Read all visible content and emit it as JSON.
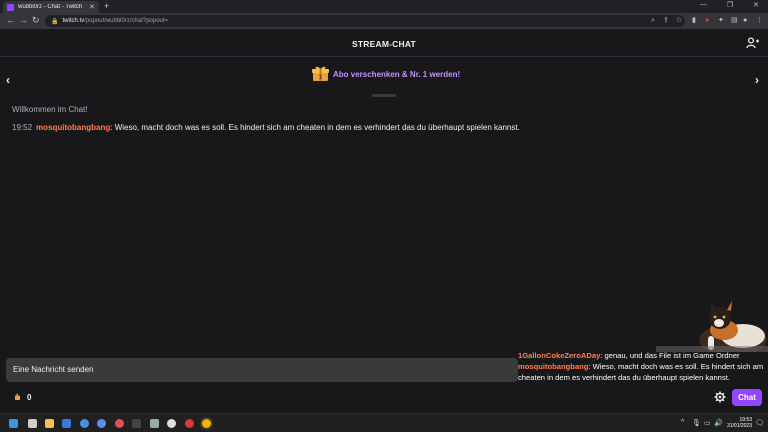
{
  "browser": {
    "tab_title": "wubbl0rz - Chat - Twitch",
    "url_domain": "twitch.tv",
    "url_path": "/popout/wubbl0rz/chat?popout="
  },
  "chat": {
    "title": "STREAM-CHAT",
    "banner_text": "Abo verschenken & Nr. 1 werden!",
    "welcome": "Willkommen im Chat!",
    "messages": [
      {
        "time": "19:52",
        "user": "mosquitobangbang",
        "text": ": Wieso, macht doch was es soll. Es hindert sich am cheaten in dem es verhindert das du überhaupt spielen kannst."
      }
    ],
    "input_placeholder": "Eine Nachricht senden",
    "points": "0",
    "chat_button": "Chat"
  },
  "overlay": {
    "messages": [
      {
        "user": "1GallonCokeZeroADay",
        "text": ": genau, und das File ist im Game Ordner"
      },
      {
        "user": "mosquitobangbang",
        "text": ": Wieso, macht doch was es soll. Es hindert sich am cheaten in dem es verhindert das du überhaupt spielen kannst."
      }
    ]
  },
  "taskbar": {
    "time": "19:53",
    "date": "31/01/2023"
  },
  "colors": {
    "accent": "#9147ff",
    "banner_text": "#bf94ff",
    "username": "#ff7f50",
    "background": "#18181b"
  }
}
